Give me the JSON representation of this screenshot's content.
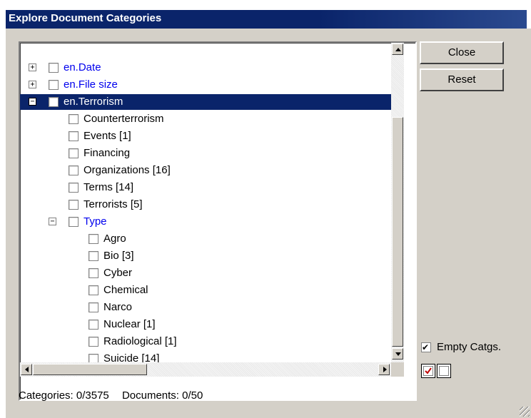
{
  "window": {
    "title": "Explore Document Categories"
  },
  "tree": {
    "nodes": [
      {
        "label": "en.Date",
        "expander": "+",
        "category": true
      },
      {
        "label": "en.File size",
        "expander": "+",
        "category": true
      },
      {
        "label": "en.Terrorism",
        "expander": "−",
        "category": true,
        "selected": true
      },
      {
        "label": "Counterterrorism"
      },
      {
        "label": "Events [1]"
      },
      {
        "label": "Financing"
      },
      {
        "label": "Organizations [16]"
      },
      {
        "label": "Terms [14]"
      },
      {
        "label": "Terrorists [5]"
      },
      {
        "label": "Type",
        "expander": "−",
        "category": true
      },
      {
        "label": "Agro"
      },
      {
        "label": "Bio [3]"
      },
      {
        "label": "Cyber"
      },
      {
        "label": "Chemical"
      },
      {
        "label": "Narco"
      },
      {
        "label": "Nuclear [1]"
      },
      {
        "label": "Radiological [1]"
      },
      {
        "label": "Suicide [14]"
      }
    ]
  },
  "buttons": {
    "close": {
      "label": "Close"
    },
    "reset": {
      "label": "Reset"
    }
  },
  "options": {
    "empty_catgs": {
      "label": "Empty Catgs.",
      "checked": true
    }
  },
  "status": {
    "categories": "Categories: 0/3575",
    "documents": "Documents: 0/50"
  },
  "colors": {
    "selection": "#0a246a",
    "category_link": "#0000ee",
    "dialog_bg": "#d4d0c8"
  }
}
